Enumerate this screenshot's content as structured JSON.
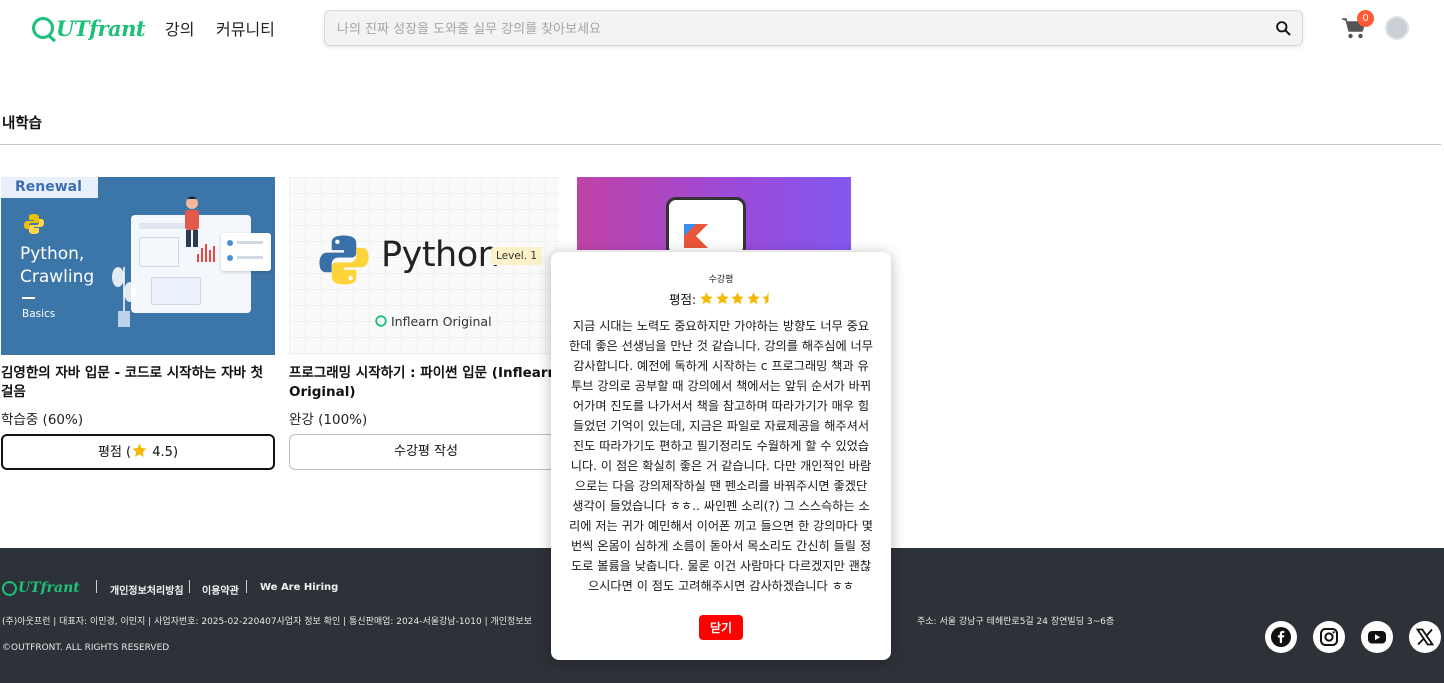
{
  "header": {
    "logo_text": "UTfrant",
    "nav": [
      "강의",
      "커뮤니티"
    ],
    "search_placeholder": "나의 진짜 성장을 도와줄 실무 강의를 찾아보세요",
    "cart_count": "0"
  },
  "main": {
    "section_title": "내학습",
    "courses": [
      {
        "thumb_badge": "Renewal",
        "thumb_title_1": "Python,",
        "thumb_title_2": "Crawling",
        "thumb_sub": "Basics",
        "title": "김영한의 자바 입문 - 코드로 시작하는 자바 첫걸음",
        "progress": "학습중 (60%)",
        "button_prefix": "평점 (",
        "button_rating": "4.5",
        "button_suffix": ")"
      },
      {
        "thumb_word": "Python",
        "thumb_level": "Level. 1",
        "thumb_origin": "Inflearn Original",
        "title": "프로그래밍 시작하기 : 파이썬 입문 (Inflearn Original)",
        "progress": "완강 (100%)",
        "button": "수강평 작성"
      }
    ]
  },
  "modal": {
    "title": "수강평",
    "rating_label": "평점:",
    "rating_value": 4.5,
    "review": "지금 시대는 노력도 중요하지만 가야하는 방향도 너무 중요한데 좋은 선생님을 만난 것 같습니다. 강의를 해주심에 너무 감사합니다. 예전에 독하게 시작하는 c 프로그래밍 책과 유투브 강의로 공부할 때 강의에서 책에서는 앞뒤 순서가 바뀌어가며 진도를 나가서서 책을 참고하며 따라가기가 매우 힘들었던 기억이 있는데, 지금은 파일로 자료제공을 해주셔서 진도 따라가기도 편하고 필기정리도 수월하게 할 수 있었습니다. 이 점은 확실히 좋은 거 같습니다. 다만 개인적인 바람으로는 다음 강의제작하실 땐 펜소리를 바꿔주시면 좋겠단 생각이 들었습니다 ㅎㅎ.. 싸인펜 소리(?) 그 스스슥하는 소리에 저는 귀가 예민해서 이어폰 끼고 들으면 한 강의마다 몇 번씩 온몸이 심하게 소름이 돋아서 목소리도 간신히 들릴 정도로 볼륨을 낮춥니다. 물론 이건 사람마다 다르겠지만 괜찮으시다면 이 점도 고려해주시면 감사하겠습니다 ㅎㅎ",
    "close_label": "닫기"
  },
  "footer": {
    "logo_text": "UTfrant",
    "links": [
      "개인정보처리방침",
      "이용약관",
      "We Are Hiring"
    ],
    "info_left": "(주)아웃프런 | 대표자: 이민경, 이민지 | 사업자번호: 2025-02-220407사업자 정보 확인 | 통신판매업: 2024-서울강남-1010 | 개인정보보",
    "info_right": "주소: 서울 강남구 테헤란로5길 24 장연빌딩 3~6층",
    "copyright": "©OUTFRONT. ALL RIGHTS RESERVED",
    "social": [
      "facebook-icon",
      "instagram-icon",
      "youtube-icon",
      "x-icon"
    ]
  },
  "colors": {
    "brand": "#1dc078",
    "footer_bg": "#2d3238",
    "close_button": "#ff0000",
    "badge": "#ff5a36",
    "star": "#f5b800"
  }
}
